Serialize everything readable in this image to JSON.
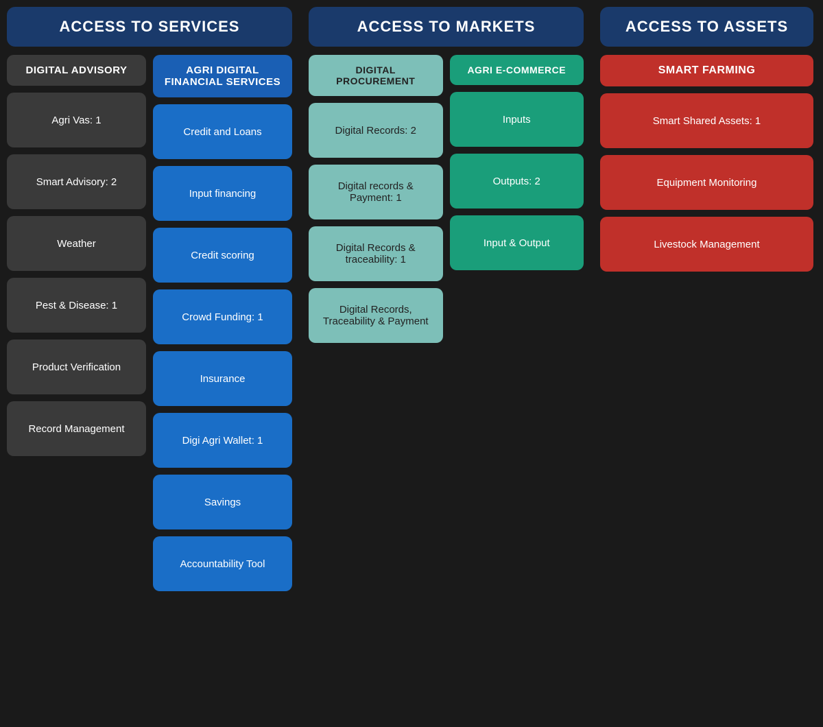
{
  "columns": {
    "services": {
      "header": "ACCESS TO SERVICES",
      "sub1": {
        "header": "DIGITAL ADVISORY",
        "cards": [
          "Agri Vas: 1",
          "Smart Advisory: 2",
          "Weather",
          "Pest & Disease: 1",
          "Product Verification",
          "Record Management"
        ]
      },
      "sub2": {
        "header": "AGRI DIGITAL FINANCIAL SERVICES",
        "cards": [
          "Credit and Loans",
          "Input financing",
          "Credit scoring",
          "Crowd Funding: 1",
          "Insurance",
          "Digi Agri Wallet: 1",
          "Savings",
          "Accountability Tool"
        ]
      }
    },
    "markets": {
      "header": "ACCESS TO MARKETS",
      "sub1": {
        "header": "DIGITAL PROCUREMENT",
        "cards": [
          "Digital Records: 2",
          "Digital records & Payment: 1",
          "Digital Records & traceability: 1",
          "Digital Records, Traceability & Payment"
        ]
      },
      "sub2": {
        "header": "AGRI E-COMMERCE",
        "cards": [
          "Inputs",
          "Outputs: 2",
          "Input & Output"
        ]
      }
    },
    "assets": {
      "header": "ACCESS TO ASSETS",
      "header_sub": "SMART FARMING",
      "cards": [
        "Smart Shared Assets: 1",
        "Equipment Monitoring",
        "Livestock Management"
      ]
    }
  }
}
